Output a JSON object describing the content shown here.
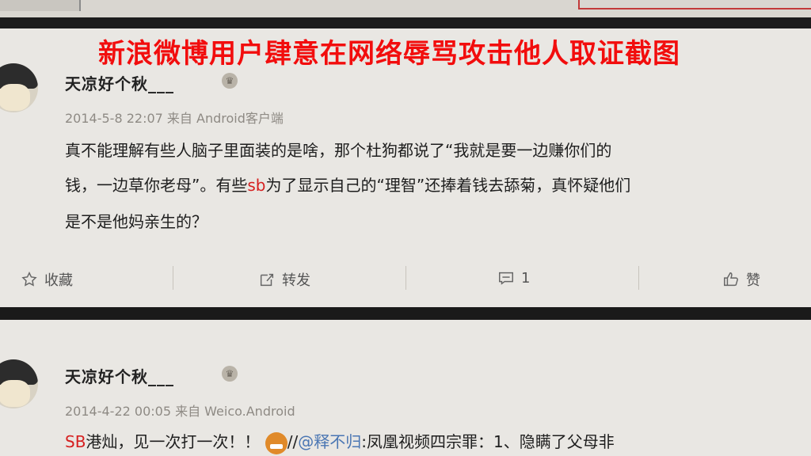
{
  "overlay_title": "新浪微博用户肆意在网络辱骂攻击他人取证截图",
  "posts": [
    {
      "username": "天凉好个秋___",
      "meta": "2014-5-8 22:07 来自 Android客户端",
      "line1": "真不能理解有些人脑子里面装的是啥，那个杜狗都说了“我就是要一边赚你们的",
      "line2_a": "钱，一边草你老母”。有些",
      "line2_red": "sb",
      "line2_b": "为了显示自己的“理智”还捧着钱去舔菊，真怀疑他们",
      "line3": "是不是他妈亲生的？",
      "actions": {
        "favorite": "收藏",
        "repost": "转发",
        "comment_count": "1",
        "like": "赞"
      }
    },
    {
      "username": "天凉好个秋___",
      "meta": "2014-4-22 00:05 来自 Weico.Android",
      "line1_red": "SB",
      "line1_a": "港灿，见一次打一次！！",
      "line1_slash": "//",
      "line1_mention": "@释不归",
      "line1_b": ":凤凰视频四宗罪：1、隐瞒了父母",
      "ellipsis": "非"
    }
  ],
  "colors": {
    "overlay_red": "#f20d0d",
    "highlight_red": "#d62020",
    "mention_blue": "#4a76b3"
  }
}
